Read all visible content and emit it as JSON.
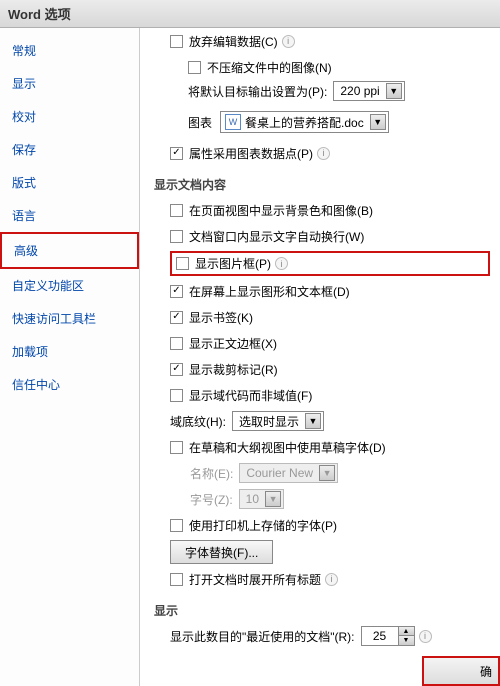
{
  "window": {
    "title": "Word 选项"
  },
  "sidebar": {
    "items": [
      {
        "label": "常规"
      },
      {
        "label": "显示"
      },
      {
        "label": "校对"
      },
      {
        "label": "保存"
      },
      {
        "label": "版式"
      },
      {
        "label": "语言"
      },
      {
        "label": "高级"
      },
      {
        "label": "自定义功能区"
      },
      {
        "label": "快速访问工具栏"
      },
      {
        "label": "加载项"
      },
      {
        "label": "信任中心"
      }
    ]
  },
  "top": {
    "discard_edit": "放弃编辑数据(C)",
    "no_compress": "不压缩文件中的图像(N)",
    "default_output_label": "将默认目标输出设置为(P):",
    "default_output_value": "220 ppi",
    "chart_label": "图表",
    "file_value": "餐桌上的营养搭配.doc",
    "chart_data_points": "属性采用图表数据点(P)"
  },
  "section1": {
    "title": "显示文档内容",
    "bg_colors": "在页面视图中显示背景色和图像(B)",
    "wrap_text": "文档窗口内显示文字自动换行(W)",
    "pic_placeholders": "显示图片框(P)",
    "drawings": "在屏幕上显示图形和文本框(D)",
    "bookmarks": "显示书签(K)",
    "text_boundaries": "显示正文边框(X)",
    "crop_marks": "显示裁剪标记(R)",
    "field_codes": "显示域代码而非域值(F)",
    "field_shading_label": "域底纹(H):",
    "field_shading_value": "选取时显示",
    "draft_font": "在草稿和大纲视图中使用草稿字体(D)",
    "font_name_label": "名称(E):",
    "font_name_value": "Courier New",
    "font_size_label": "字号(Z):",
    "font_size_value": "10",
    "printer_fonts": "使用打印机上存储的字体(P)",
    "font_subst_btn": "字体替换(F)...",
    "expand_headings": "打开文档时展开所有标题"
  },
  "section2": {
    "title": "显示",
    "recent_docs_label": "显示此数目的\"最近使用的文档\"(R):",
    "recent_docs_value": "25"
  },
  "bottom": {
    "ok": "确"
  }
}
